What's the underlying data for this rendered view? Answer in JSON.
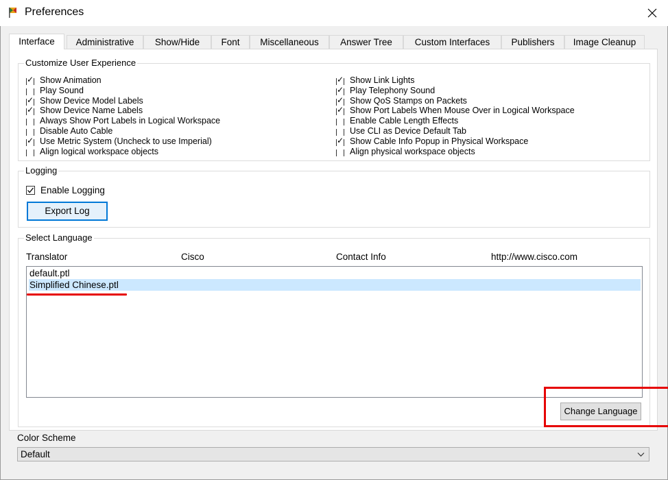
{
  "window": {
    "title": "Preferences",
    "app_icon": "packet-tracer-icon",
    "close_icon": "close-icon"
  },
  "tabs": [
    {
      "label": "Interface",
      "active": true
    },
    {
      "label": "Administrative"
    },
    {
      "label": "Show/Hide"
    },
    {
      "label": "Font"
    },
    {
      "label": "Miscellaneous"
    },
    {
      "label": "Answer Tree"
    },
    {
      "label": "Custom Interfaces"
    },
    {
      "label": "Publishers"
    },
    {
      "label": "Image Cleanup"
    }
  ],
  "ux": {
    "title": "Customize User Experience",
    "left": [
      {
        "label": "Show Animation",
        "checked": true
      },
      {
        "label": "Play Sound",
        "checked": false
      },
      {
        "label": "Show Device Model Labels",
        "checked": true
      },
      {
        "label": "Show Device Name Labels",
        "checked": true
      },
      {
        "label": "Always Show Port Labels in Logical Workspace",
        "checked": false
      },
      {
        "label": "Disable Auto Cable",
        "checked": false
      },
      {
        "label": "Use Metric System (Uncheck to use Imperial)",
        "checked": true
      },
      {
        "label": "Align logical workspace objects",
        "checked": false
      }
    ],
    "right": [
      {
        "label": "Show Link Lights",
        "checked": true
      },
      {
        "label": "Play Telephony Sound",
        "checked": true
      },
      {
        "label": "Show QoS Stamps on Packets",
        "checked": true
      },
      {
        "label": "Show Port Labels When Mouse Over in Logical Workspace",
        "checked": true
      },
      {
        "label": "Enable Cable Length Effects",
        "checked": false
      },
      {
        "label": "Use CLI as Device Default Tab",
        "checked": false
      },
      {
        "label": "Show Cable Info Popup in Physical Workspace",
        "checked": true
      },
      {
        "label": "Align physical workspace objects",
        "checked": false
      }
    ]
  },
  "logging": {
    "title": "Logging",
    "enable_label": "Enable Logging",
    "enabled": true,
    "export_label": "Export Log"
  },
  "language": {
    "title": "Select Language",
    "headers": [
      "Translator",
      "Cisco",
      "Contact Info",
      "http://www.cisco.com"
    ],
    "items": [
      "default.ptl",
      "Simplified Chinese.ptl"
    ],
    "selected_index": 1,
    "change_label": "Change Language"
  },
  "color_scheme": {
    "label": "Color Scheme",
    "value": "Default",
    "chevron_icon": "chevron-down-icon"
  },
  "colors": {
    "selection": "#cce8ff",
    "accent": "#0078d7",
    "annotation": "#e60000"
  }
}
